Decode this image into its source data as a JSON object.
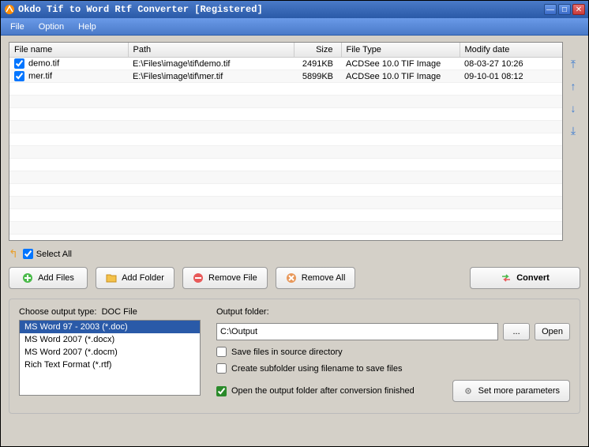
{
  "titlebar": {
    "title": "Okdo Tif to Word Rtf Converter [Registered]"
  },
  "menu": {
    "file": "File",
    "option": "Option",
    "help": "Help"
  },
  "columns": {
    "name": "File name",
    "path": "Path",
    "size": "Size",
    "type": "File Type",
    "date": "Modify date"
  },
  "rows": [
    {
      "checked": true,
      "name": "demo.tif",
      "path": "E:\\Files\\image\\tif\\demo.tif",
      "size": "2491KB",
      "type": "ACDSee 10.0 TIF Image",
      "date": "08-03-27 10:26"
    },
    {
      "checked": true,
      "name": "mer.tif",
      "path": "E:\\Files\\image\\tif\\mer.tif",
      "size": "5899KB",
      "type": "ACDSee 10.0 TIF Image",
      "date": "09-10-01 08:12"
    }
  ],
  "selectAll": {
    "label": "Select All",
    "checked": true
  },
  "buttons": {
    "addFiles": "Add Files",
    "addFolder": "Add Folder",
    "removeFile": "Remove File",
    "removeAll": "Remove All",
    "convert": "Convert",
    "browse": "...",
    "open": "Open",
    "setMore": "Set more parameters"
  },
  "outputType": {
    "label": "Choose output type:",
    "current": "DOC File",
    "options": [
      "MS Word 97 - 2003 (*.doc)",
      "MS Word 2007 (*.docx)",
      "MS Word 2007 (*.docm)",
      "Rich Text Format (*.rtf)"
    ],
    "selectedIndex": 0
  },
  "outputFolder": {
    "label": "Output folder:",
    "value": "C:\\Output"
  },
  "options": {
    "saveInSource": {
      "label": "Save files in source directory",
      "checked": false
    },
    "createSubfolder": {
      "label": "Create subfolder using filename to save files",
      "checked": false
    },
    "openAfter": {
      "label": "Open the output folder after conversion finished",
      "checked": true
    }
  }
}
